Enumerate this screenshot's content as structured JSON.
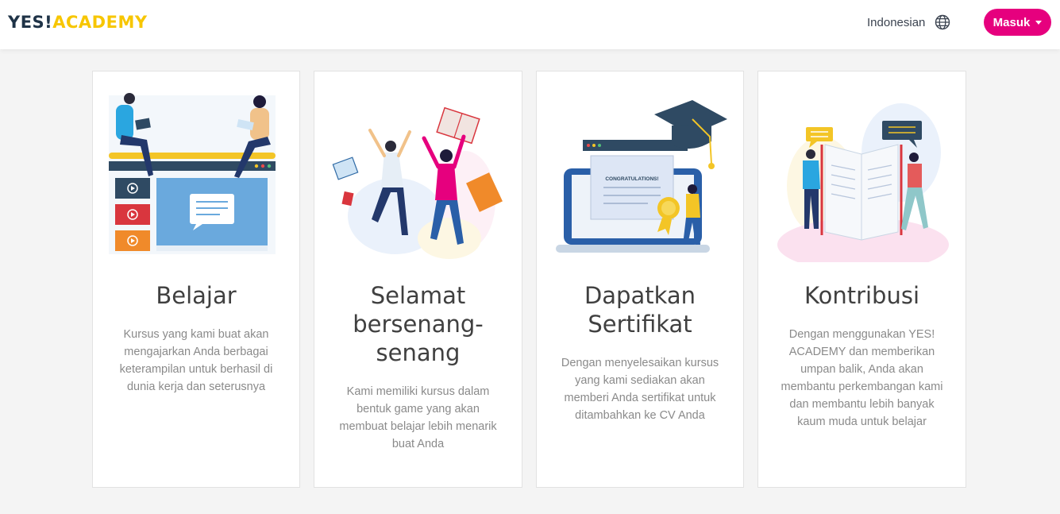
{
  "header": {
    "logo_part1": "YES!",
    "logo_part2": "ACADEMY",
    "language": "Indonesian",
    "login_label": "Masuk"
  },
  "colors": {
    "brand_pink": "#e6007e",
    "brand_yellow": "#f7c600",
    "brand_navy": "#1f3347"
  },
  "icons": {
    "language": "globe-icon",
    "login_menu": "caret-down-icon"
  },
  "cards": [
    {
      "title": "Belajar",
      "description": "Kursus yang kami buat akan mengajarkan Anda berbagai keterampilan untuk berhasil di dunia kerja dan seterusnya",
      "illustration": "people-watching-video-lessons-illustration"
    },
    {
      "title": "Selamat bersenang-senang",
      "description": "Kami memiliki kursus dalam bentuk game yang akan membuat belajar lebih menarik buat Anda",
      "illustration": "people-jumping-with-books-illustration"
    },
    {
      "title": "Dapatkan Sertifikat",
      "description": "Dengan menyelesaikan kursus yang kami sediakan akan memberi Anda sertifikat untuk ditambahkan ke CV Anda",
      "illustration": "laptop-certificate-graduation-illustration",
      "certificate_text": "CONGRATULATIONS!"
    },
    {
      "title": "Kontribusi",
      "description": "Dengan menggunakan YES! ACADEMY dan memberikan umpan balik, Anda akan membantu perkembangan kami dan membantu lebih banyak kaum muda untuk belajar",
      "illustration": "people-with-giant-book-illustration"
    }
  ]
}
